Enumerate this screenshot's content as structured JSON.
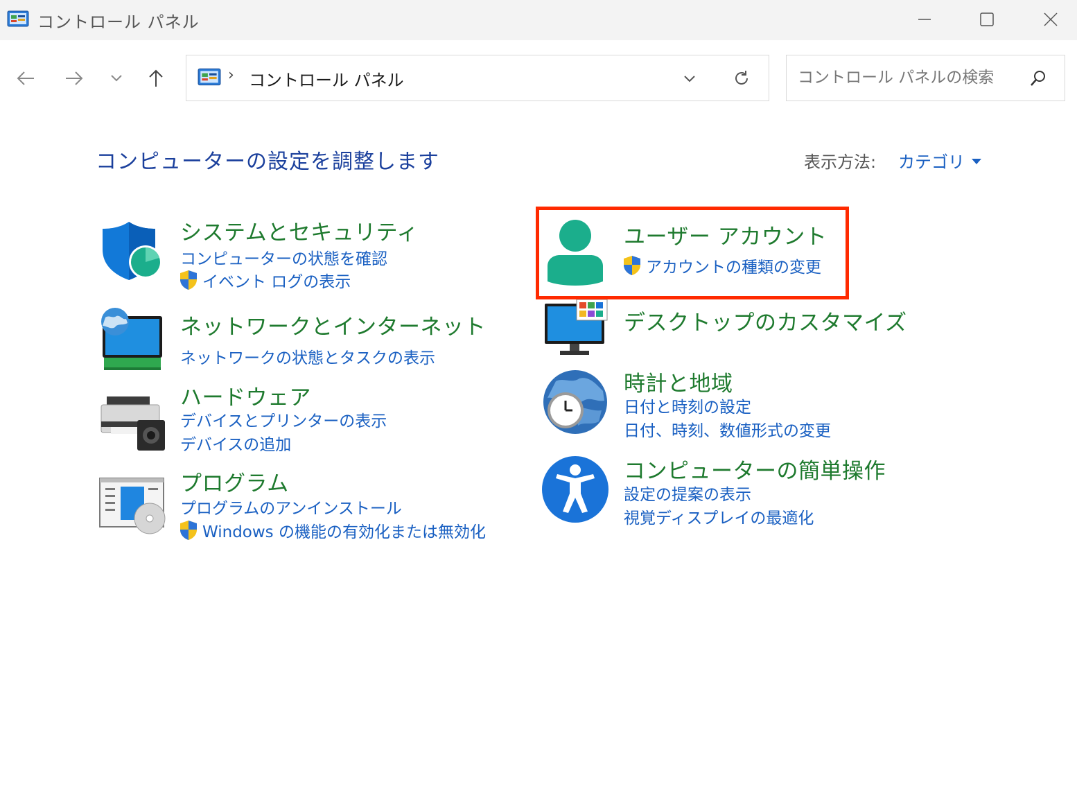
{
  "window": {
    "title": "コントロール パネル"
  },
  "address": {
    "path": "コントロール パネル",
    "separator": "›"
  },
  "search": {
    "placeholder": "コントロール パネルの検索"
  },
  "main": {
    "heading": "コンピューターの設定を調整します",
    "view_by_label": "表示方法:",
    "view_by_value": "カテゴリ"
  },
  "categories": {
    "system": {
      "title": "システムとセキュリティ",
      "links": [
        "コンピューターの状態を確認",
        "イベント ログの表示"
      ]
    },
    "network": {
      "title": "ネットワークとインターネット",
      "links": [
        "ネットワークの状態とタスクの表示"
      ]
    },
    "hardware": {
      "title": "ハードウェア",
      "links": [
        "デバイスとプリンターの表示",
        "デバイスの追加"
      ]
    },
    "programs": {
      "title": "プログラム",
      "links": [
        "プログラムのアンインストール",
        "Windows の機能の有効化または無効化"
      ]
    },
    "user_accounts": {
      "title": "ユーザー アカウント",
      "links": [
        "アカウントの種類の変更"
      ]
    },
    "appearance": {
      "title": "デスクトップのカスタマイズ",
      "links": []
    },
    "clock": {
      "title": "時計と地域",
      "links": [
        "日付と時刻の設定",
        "日付、時刻、数値形式の変更"
      ]
    },
    "ease": {
      "title": "コンピューターの簡単操作",
      "links": [
        "設定の提案の表示",
        "視覚ディスプレイの最適化"
      ]
    }
  },
  "colors": {
    "category_title": "#1e7a2e",
    "link": "#1a60c2",
    "heading": "#1a3f9c",
    "highlight_border": "#ff2a00"
  }
}
